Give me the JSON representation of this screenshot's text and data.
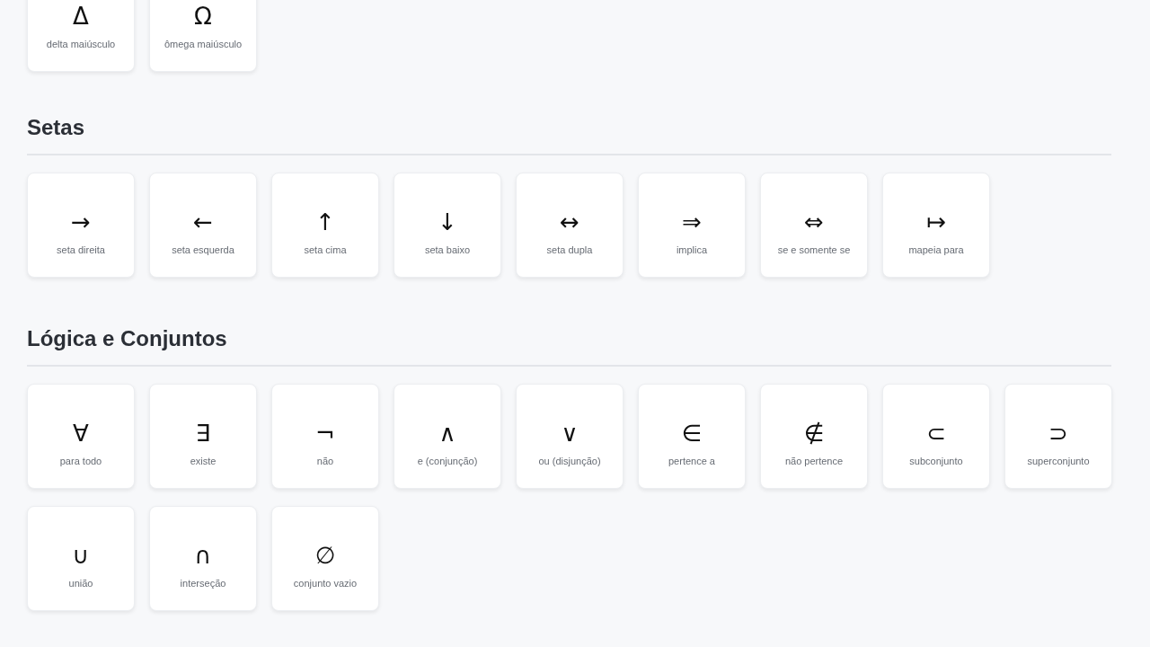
{
  "sections": [
    {
      "items": [
        {
          "symbol": "Δ",
          "label": "delta maiúsculo"
        },
        {
          "symbol": "Ω",
          "label": "ômega maiúsculo"
        }
      ]
    },
    {
      "title": "Setas",
      "items": [
        {
          "symbol": "→",
          "label": "seta direita"
        },
        {
          "symbol": "←",
          "label": "seta esquerda"
        },
        {
          "symbol": "↑",
          "label": "seta cima"
        },
        {
          "symbol": "↓",
          "label": "seta baixo"
        },
        {
          "symbol": "↔",
          "label": "seta dupla"
        },
        {
          "symbol": "⇒",
          "label": "implica"
        },
        {
          "symbol": "⇔",
          "label": "se e somente se"
        },
        {
          "symbol": "↦",
          "label": "mapeia para"
        }
      ]
    },
    {
      "title": "Lógica e Conjuntos",
      "items": [
        {
          "symbol": "∀",
          "label": "para todo"
        },
        {
          "symbol": "∃",
          "label": "existe"
        },
        {
          "symbol": "¬",
          "label": "não"
        },
        {
          "symbol": "∧",
          "label": "e (conjunção)"
        },
        {
          "symbol": "∨",
          "label": "ou (disjunção)"
        },
        {
          "symbol": "∈",
          "label": "pertence a"
        },
        {
          "symbol": "∉",
          "label": "não pertence"
        },
        {
          "symbol": "⊂",
          "label": "subconjunto"
        },
        {
          "symbol": "⊃",
          "label": "superconjunto"
        },
        {
          "symbol": "∪",
          "label": "união"
        },
        {
          "symbol": "∩",
          "label": "interseção"
        },
        {
          "symbol": "∅",
          "label": "conjunto vazio"
        }
      ]
    }
  ]
}
